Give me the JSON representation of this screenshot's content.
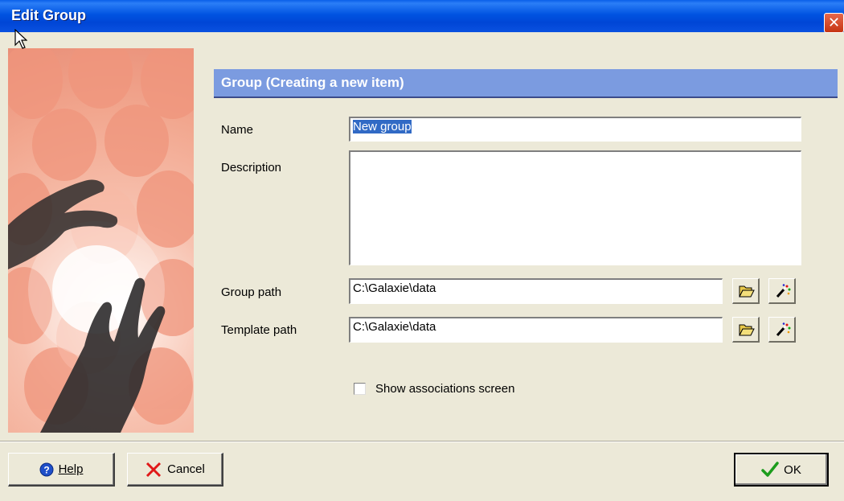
{
  "window": {
    "title": "Edit Group",
    "close_label": "✕"
  },
  "section": {
    "header": "Group (Creating a new item)"
  },
  "form": {
    "name_label": "Name",
    "name_value": "New group",
    "description_label": "Description",
    "description_value": "",
    "group_path_label": "Group path",
    "group_path_value": "C:\\Galaxie\\data",
    "template_path_label": "Template path",
    "template_path_value": "C:\\Galaxie\\data",
    "show_associations_label": "Show associations screen",
    "show_associations_checked": false
  },
  "buttons": {
    "help_label": "Help",
    "cancel_label": "Cancel",
    "ok_label": "OK"
  },
  "icons": {
    "browse": "open-folder-icon",
    "wizard": "magic-wand-icon",
    "help": "help-icon",
    "cancel": "cancel-x-icon",
    "ok": "checkmark-icon"
  },
  "colors": {
    "titlebar": "#0053e1",
    "section_header": "#7b9be0",
    "dialog_background": "#ece9d8",
    "selection": "#316ac5"
  }
}
